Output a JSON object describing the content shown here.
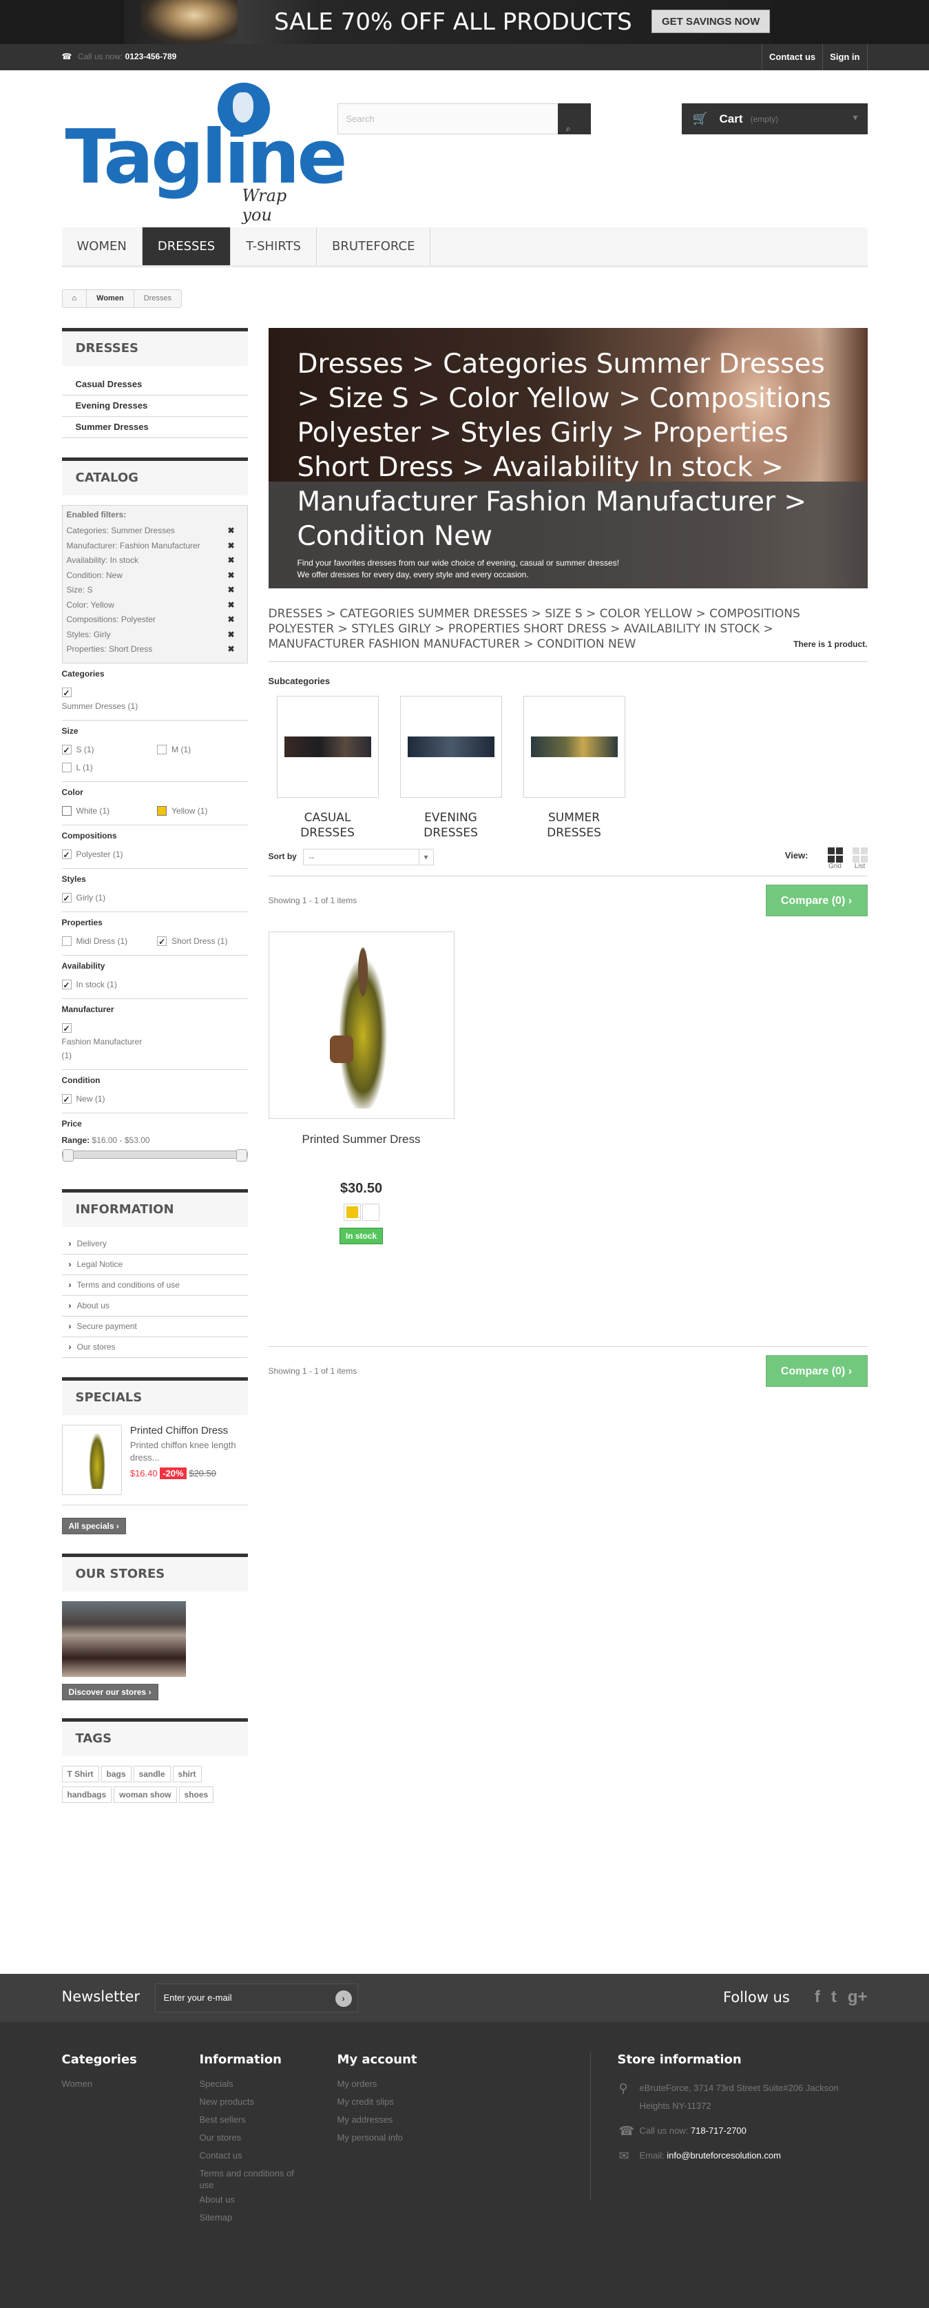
{
  "promo": {
    "text": "SALE 70% OFF ALL PRODUCTS",
    "button": "GET SAVINGS NOW"
  },
  "topnav": {
    "call_label": "Call us now:",
    "phone": "0123-456-789",
    "links": [
      "Contact us",
      "Sign in"
    ]
  },
  "logo": {
    "word": "Tagline",
    "tagline": "Wrap you"
  },
  "search": {
    "placeholder": "Search"
  },
  "cart": {
    "label": "Cart",
    "status": "(empty)"
  },
  "menu": [
    "WOMEN",
    "DRESSES",
    "T-SHIRTS",
    "BRUTEFORCE"
  ],
  "breadcrumb": [
    "Women",
    "Dresses"
  ],
  "sidebar": {
    "dresses_title": "DRESSES",
    "dresses_items": [
      "Casual Dresses",
      "Evening Dresses",
      "Summer Dresses"
    ],
    "catalog_title": "CATALOG",
    "enabled_title": "Enabled filters:",
    "enabled_filters": [
      "Categories: Summer Dresses",
      "Manufacturer: Fashion Manufacturer",
      "Availability: In stock",
      "Condition: New",
      "Size: S",
      "Color: Yellow",
      "Compositions: Polyester",
      "Styles: Girly",
      "Properties: Short Dress"
    ],
    "filters": {
      "categories": {
        "title": "Categories",
        "items": [
          "Summer Dresses (1)"
        ]
      },
      "size": {
        "title": "Size",
        "items": [
          "S (1)",
          "M (1)",
          "L (1)"
        ]
      },
      "color": {
        "title": "Color",
        "items": [
          "White (1)",
          "Yellow (1)"
        ]
      },
      "compositions": {
        "title": "Compositions",
        "items": [
          "Polyester (1)"
        ]
      },
      "styles": {
        "title": "Styles",
        "items": [
          "Girly (1)"
        ]
      },
      "properties": {
        "title": "Properties",
        "items": [
          "Midi Dress (1)",
          "Short Dress (1)"
        ]
      },
      "availability": {
        "title": "Availability",
        "items": [
          "In stock (1)"
        ]
      },
      "manufacturer": {
        "title": "Manufacturer",
        "items": [
          "Fashion Manufacturer (1)"
        ]
      },
      "condition": {
        "title": "Condition",
        "items": [
          "New (1)"
        ]
      },
      "price": {
        "title": "Price",
        "range_label": "Range:",
        "range_value": "$16.00 - $53.00"
      }
    },
    "information_title": "INFORMATION",
    "information_items": [
      "Delivery",
      "Legal Notice",
      "Terms and conditions of use",
      "About us",
      "Secure payment",
      "Our stores"
    ],
    "specials_title": "SPECIALS",
    "special": {
      "name": "Printed Chiffon Dress",
      "desc": "Printed chiffon knee length dress...",
      "price": "$16.40",
      "discount": "-20%",
      "old_price": "$20.50"
    },
    "all_specials": "All specials",
    "stores_title": "OUR STORES",
    "discover": "Discover our stores",
    "tags_title": "TAGS",
    "tags": [
      "T Shirt",
      "bags",
      "sandle",
      "shirt",
      "handbags",
      "woman show",
      "shoes"
    ]
  },
  "main": {
    "category_title": "Dresses > Categories Summer Dresses > Size S > Color Yellow > Compositions Polyester > Styles Girly > Properties Short Dress > Availability In stock > Manufacturer Fashion Manufacturer > Condition New",
    "desc1": "Find your favorites dresses from our wide choice of evening, casual or summer dresses!",
    "desc2": "We offer dresses for every day, every style and every occasion.",
    "heading": "DRESSES > CATEGORIES SUMMER DRESSES > SIZE S > COLOR YELLOW > COMPOSITIONS POLYESTER > STYLES GIRLY > PROPERTIES SHORT DRESS > AVAILABILITY IN STOCK > MANUFACTURER FASHION MANUFACTURER > CONDITION NEW",
    "count": "There is 1 product.",
    "subcategories_title": "Subcategories",
    "subcategories": [
      "CASUAL DRESSES",
      "EVENING DRESSES",
      "SUMMER DRESSES"
    ],
    "sort_label": "Sort by",
    "sort_value": "--",
    "view_label": "View:",
    "view_grid": "Grid",
    "view_list": "List",
    "showing": "Showing 1 - 1 of 1 items",
    "compare": "Compare (0)",
    "product": {
      "name": "Printed Summer Dress",
      "price": "$30.50",
      "stock": "In stock"
    }
  },
  "footer": {
    "newsletter_title": "Newsletter",
    "newsletter_placeholder": "Enter your e-mail",
    "follow_title": "Follow us",
    "categories_title": "Categories",
    "categories": [
      "Women"
    ],
    "information_title": "Information",
    "information": [
      "Specials",
      "New products",
      "Best sellers",
      "Our stores",
      "Contact us",
      "Terms and conditions of",
      "use",
      "About us",
      "Sitemap"
    ],
    "account_title": "My account",
    "account": [
      "My orders",
      "My credit slips",
      "My addresses",
      "My personal info"
    ],
    "store_title": "Store information",
    "address_line1": "eBruteForce, 3714 73rd Street Suite#206 Jackson",
    "address_line2": "Heights NY-11372",
    "call_label": "Call us now:",
    "phone": "718-717-2700",
    "email_label": "Email:",
    "email": "info@bruteforcesolution.com"
  },
  "colors": {
    "dark": "#333333",
    "blue": "#1d6fbb",
    "green": "#43b754",
    "red": "#f13340",
    "yellow": "#f1c40f"
  }
}
